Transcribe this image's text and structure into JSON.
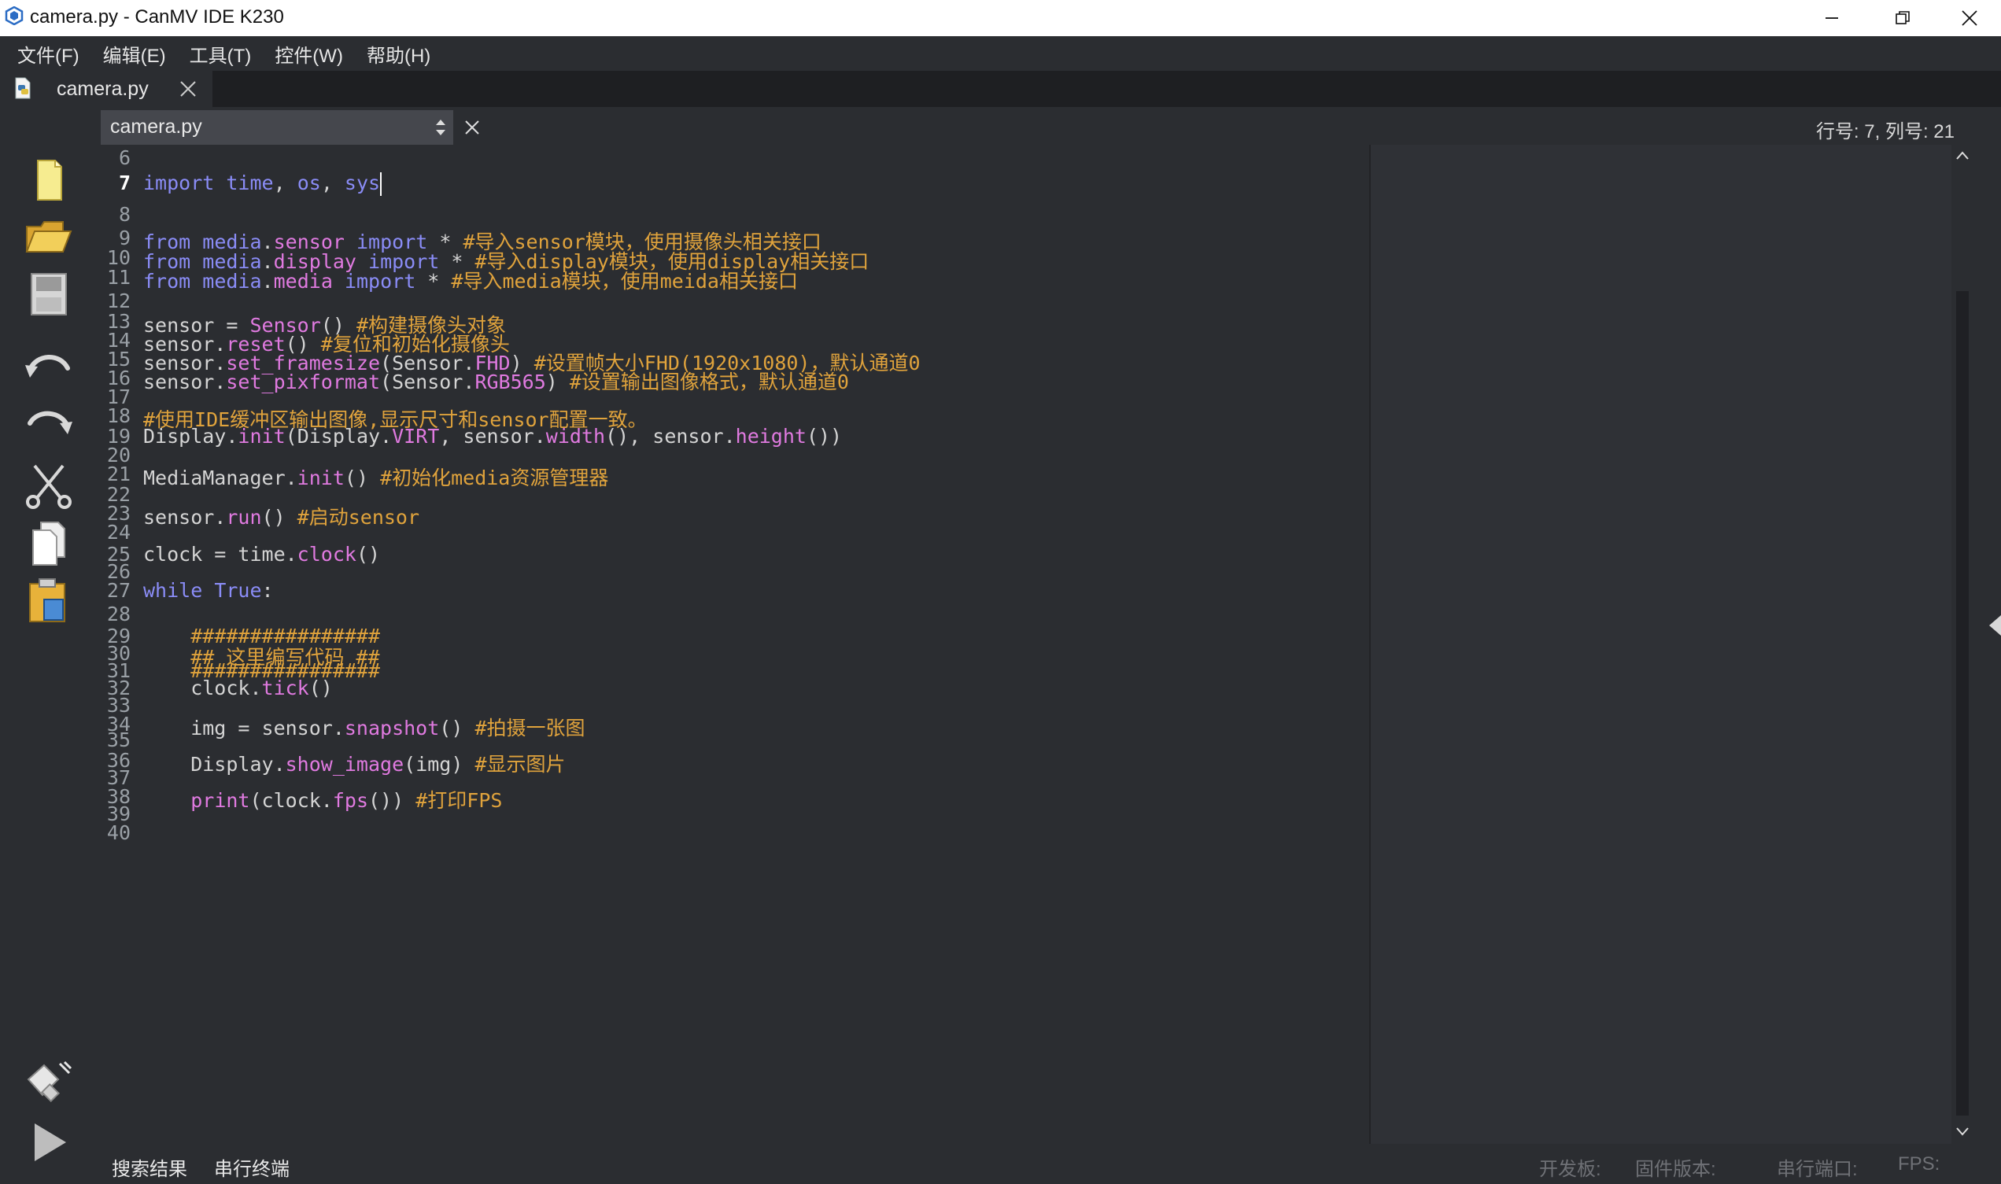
{
  "window": {
    "title": "camera.py - CanMV IDE K230",
    "minimize_glyph": "—",
    "maximize_glyph": "❐",
    "close_glyph": "✕"
  },
  "menu": [
    "文件(F)",
    "编辑(E)",
    "工具(T)",
    "控件(W)",
    "帮助(H)"
  ],
  "tab": {
    "label": "camera.py",
    "icon": "python-file-icon"
  },
  "doc": {
    "file": "camera.py",
    "cursor_position": "行号: 7, 列号: 21"
  },
  "toolbar": [
    "new-file-icon",
    "open-folder-icon",
    "save-icon",
    "undo-icon",
    "redo-icon",
    "cut-icon",
    "copy-icon",
    "paste-icon",
    "connect-icon",
    "run-icon"
  ],
  "editor": {
    "current_line": 7,
    "lines": [
      {
        "n": "6",
        "parts": []
      },
      {
        "n": "7",
        "parts": [
          [
            "kw",
            "import"
          ],
          [
            "p",
            " "
          ],
          [
            "kw",
            "time"
          ],
          [
            "p",
            ", "
          ],
          [
            "kw",
            "os"
          ],
          [
            "p",
            ", "
          ],
          [
            "kw",
            "sys"
          ]
        ]
      },
      {
        "n": "8",
        "parts": []
      },
      {
        "n": "9",
        "parts": [
          [
            "kw",
            "from"
          ],
          [
            "p",
            " "
          ],
          [
            "kw",
            "media"
          ],
          [
            "p",
            "."
          ],
          [
            "fn",
            "sensor"
          ],
          [
            "p",
            " "
          ],
          [
            "kw",
            "import"
          ],
          [
            "p",
            " * "
          ],
          [
            "cm",
            "#导入sensor模块，使用摄像头相关接口"
          ]
        ]
      },
      {
        "n": "10",
        "parts": [
          [
            "kw",
            "from"
          ],
          [
            "p",
            " "
          ],
          [
            "kw",
            "media"
          ],
          [
            "p",
            "."
          ],
          [
            "fn",
            "display"
          ],
          [
            "p",
            " "
          ],
          [
            "kw",
            "import"
          ],
          [
            "p",
            " * "
          ],
          [
            "cm",
            "#导入display模块，使用display相关接口"
          ]
        ]
      },
      {
        "n": "11",
        "parts": [
          [
            "kw",
            "from"
          ],
          [
            "p",
            " "
          ],
          [
            "kw",
            "media"
          ],
          [
            "p",
            "."
          ],
          [
            "fn",
            "media"
          ],
          [
            "p",
            " "
          ],
          [
            "kw",
            "import"
          ],
          [
            "p",
            " * "
          ],
          [
            "cm",
            "#导入media模块，使用meida相关接口"
          ]
        ]
      },
      {
        "n": "12",
        "parts": []
      },
      {
        "n": "13",
        "parts": [
          [
            "p",
            "sensor = "
          ],
          [
            "fn",
            "Sensor"
          ],
          [
            "p",
            "() "
          ],
          [
            "cm",
            "#构建摄像头对象"
          ]
        ]
      },
      {
        "n": "14",
        "parts": [
          [
            "p",
            "sensor."
          ],
          [
            "fn",
            "reset"
          ],
          [
            "p",
            "() "
          ],
          [
            "cm",
            "#复位和初始化摄像头"
          ]
        ]
      },
      {
        "n": "15",
        "parts": [
          [
            "p",
            "sensor."
          ],
          [
            "fn",
            "set_framesize"
          ],
          [
            "p",
            "(Sensor."
          ],
          [
            "fn",
            "FHD"
          ],
          [
            "p",
            ") "
          ],
          [
            "cm",
            "#设置帧大小FHD(1920x1080)，默认通道0"
          ]
        ]
      },
      {
        "n": "16",
        "parts": [
          [
            "p",
            "sensor."
          ],
          [
            "fn",
            "set_pixformat"
          ],
          [
            "p",
            "(Sensor."
          ],
          [
            "fn",
            "RGB565"
          ],
          [
            "p",
            ") "
          ],
          [
            "cm",
            "#设置输出图像格式，默认通道0"
          ]
        ]
      },
      {
        "n": "17",
        "parts": []
      },
      {
        "n": "18",
        "parts": [
          [
            "cm",
            "#使用IDE缓冲区输出图像,显示尺寸和sensor配置一致。"
          ]
        ]
      },
      {
        "n": "19",
        "parts": [
          [
            "p",
            "Display."
          ],
          [
            "fn",
            "init"
          ],
          [
            "p",
            "(Display."
          ],
          [
            "fn",
            "VIRT"
          ],
          [
            "p",
            ", sensor."
          ],
          [
            "fn",
            "width"
          ],
          [
            "p",
            "(), sensor."
          ],
          [
            "fn",
            "height"
          ],
          [
            "p",
            "())"
          ]
        ]
      },
      {
        "n": "20",
        "parts": []
      },
      {
        "n": "21",
        "parts": [
          [
            "p",
            "MediaManager."
          ],
          [
            "fn",
            "init"
          ],
          [
            "p",
            "() "
          ],
          [
            "cm",
            "#初始化media资源管理器"
          ]
        ]
      },
      {
        "n": "22",
        "parts": []
      },
      {
        "n": "23",
        "parts": [
          [
            "p",
            "sensor."
          ],
          [
            "fn",
            "run"
          ],
          [
            "p",
            "() "
          ],
          [
            "cm",
            "#启动sensor"
          ]
        ]
      },
      {
        "n": "24",
        "parts": []
      },
      {
        "n": "25",
        "parts": [
          [
            "p",
            "clock = time."
          ],
          [
            "fn",
            "clock"
          ],
          [
            "p",
            "()"
          ]
        ]
      },
      {
        "n": "26",
        "parts": []
      },
      {
        "n": "27",
        "parts": [
          [
            "kw",
            "while"
          ],
          [
            "p",
            " "
          ],
          [
            "kw",
            "True"
          ],
          [
            "p",
            ":"
          ]
        ]
      },
      {
        "n": "28",
        "parts": []
      },
      {
        "n": "29",
        "parts": [
          [
            "p",
            "    "
          ],
          [
            "cm",
            "################"
          ]
        ]
      },
      {
        "n": "30",
        "parts": [
          [
            "p",
            "    "
          ],
          [
            "cm",
            "## 这里编写代码 ##"
          ]
        ]
      },
      {
        "n": "31",
        "parts": [
          [
            "p",
            "    "
          ],
          [
            "cm",
            "################"
          ]
        ]
      },
      {
        "n": "32",
        "parts": [
          [
            "p",
            "    clock."
          ],
          [
            "fn",
            "tick"
          ],
          [
            "p",
            "()"
          ]
        ]
      },
      {
        "n": "33",
        "parts": []
      },
      {
        "n": "34",
        "parts": [
          [
            "p",
            "    img = sensor."
          ],
          [
            "fn",
            "snapshot"
          ],
          [
            "p",
            "() "
          ],
          [
            "cm",
            "#拍摄一张图"
          ]
        ]
      },
      {
        "n": "35",
        "parts": []
      },
      {
        "n": "36",
        "parts": [
          [
            "p",
            "    Display."
          ],
          [
            "fn",
            "show_image"
          ],
          [
            "p",
            "(img) "
          ],
          [
            "cm",
            "#显示图片"
          ]
        ]
      },
      {
        "n": "37",
        "parts": []
      },
      {
        "n": "38",
        "parts": [
          [
            "p",
            "    "
          ],
          [
            "fn",
            "print"
          ],
          [
            "p",
            "(clock."
          ],
          [
            "fn",
            "fps"
          ],
          [
            "p",
            "()) "
          ],
          [
            "cm",
            "#打印FPS"
          ]
        ]
      },
      {
        "n": "39",
        "parts": []
      },
      {
        "n": "40",
        "parts": []
      }
    ]
  },
  "bottom": {
    "tabs": [
      "搜索结果",
      "串行终端"
    ],
    "status": {
      "board": "开发板:",
      "firmware": "固件版本:",
      "port": "串行端口:",
      "fps": "FPS:"
    }
  },
  "colors": {
    "keyword": "#8a8cf6",
    "function": "#e07ae0",
    "comment": "#e0a33c",
    "text": "#d4d4d4",
    "background": "#2b2d31"
  }
}
